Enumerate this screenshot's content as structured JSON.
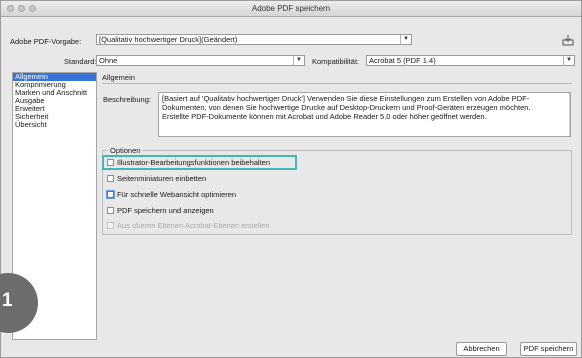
{
  "window": {
    "title": "Adobe PDF speichern"
  },
  "preset": {
    "label": "Adobe PDF-Vorgabe:",
    "value": "[Qualitativ hochwertiger Druck](Geändert)",
    "save_icon": "save-preset-icon"
  },
  "standard": {
    "label": "Standard:",
    "value": "Ohne"
  },
  "compat": {
    "label": "Kompatibilität:",
    "value": "Acrobat 5 (PDF 1.4)"
  },
  "sidebar": {
    "items": [
      {
        "label": "Allgemein",
        "selected": true
      },
      {
        "label": "Komprimierung"
      },
      {
        "label": "Marken und Anschnitt"
      },
      {
        "label": "Ausgabe"
      },
      {
        "label": "Erweitert"
      },
      {
        "label": "Sicherheit"
      },
      {
        "label": "Übersicht"
      }
    ]
  },
  "main": {
    "section_title": "Allgemein",
    "description_label": "Beschreibung:",
    "description_lines": [
      "[Basiert auf 'Qualitativ hochwertiger Druck'] Verwenden Sie diese Einstellungen zum Erstellen von Adobe PDF-",
      "Dokumenten, von denen Sie hochwertige Drucke auf Desktop-Druckern und Proof-Geräten erzeugen möchten.",
      "Erstellte PDF-Dokumente können mit Acrobat und Adobe Reader 5.0 oder höher geöffnet werden."
    ],
    "options_title": "Optionen",
    "options": [
      {
        "label": "Illustrator-Bearbeitungsfunktionen beibehalten",
        "checked": false,
        "highlighted": true
      },
      {
        "label": "Seitenminiaturen einbetten",
        "checked": false
      },
      {
        "label": "Für schnelle Webansicht optimieren",
        "checked": false
      },
      {
        "label": "PDF speichern und anzeigen",
        "checked": false
      },
      {
        "label": "Aus oberen Ebenen Acrobat-Ebenen erstellen",
        "checked": false,
        "disabled": true
      }
    ]
  },
  "callout": {
    "number": "1",
    "color": "#45b5bd"
  },
  "buttons": {
    "cancel": "Abbrechen",
    "save": "PDF speichern"
  }
}
